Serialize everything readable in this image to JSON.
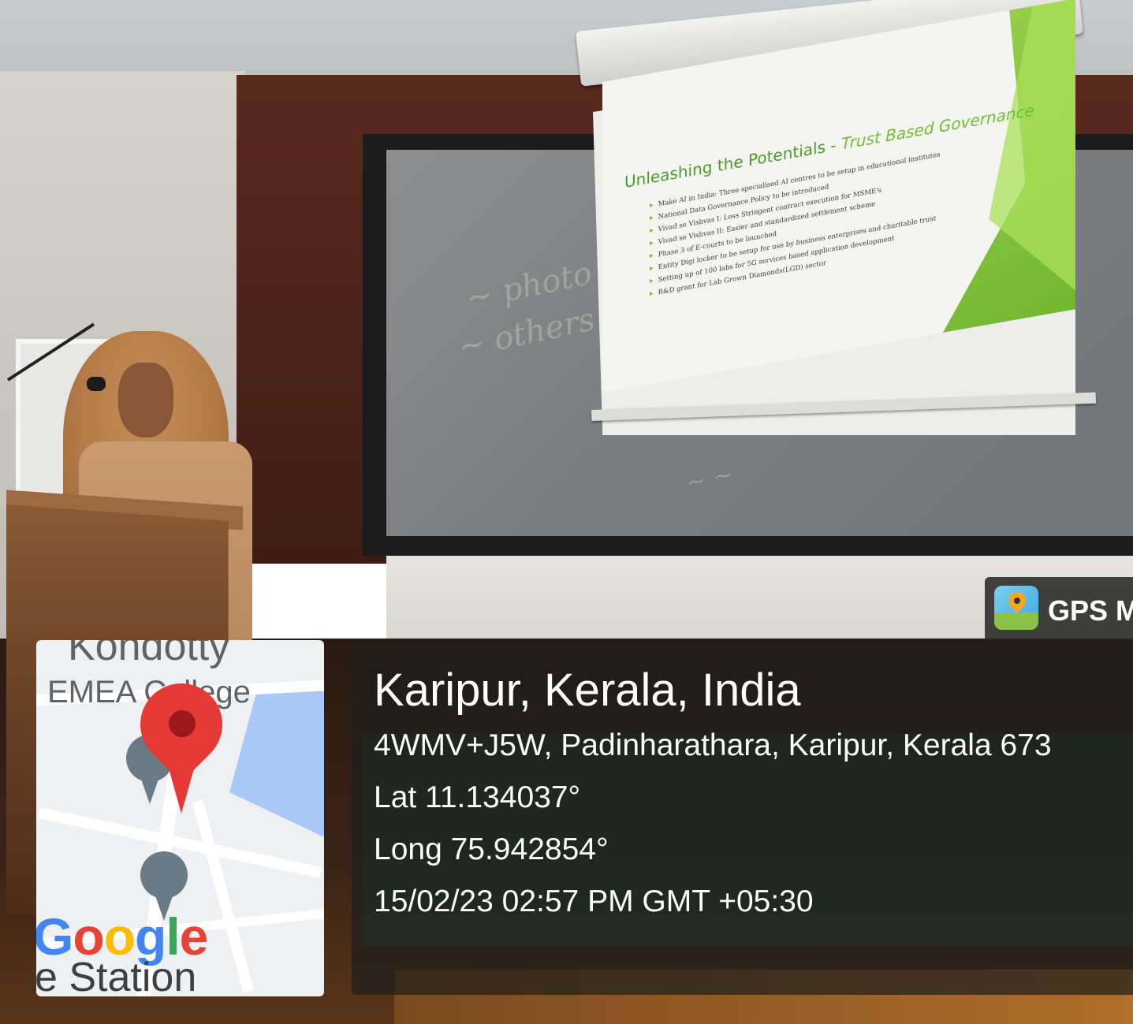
{
  "projected_slide": {
    "title_plain": "Unleashing the Potentials - ",
    "title_emphasis": "Trust Based Governance",
    "items": [
      "Make AI in India: Three specialised AI centres to be setup in educational institutes",
      "National Data Governance Policy to be introduced",
      "Vivad se Vishvas I: Less Stringent contract execution for MSME's",
      "Vivad se Vishvas II: Easier and standardized settlement scheme",
      "Phase 3 of E-courts to be launched",
      "Entity Digi locker to be setup for use by business enterprises and charitable trust",
      "Setting up of 100 labs for 5G services based application development",
      "R&D grant for Lab Grown Diamonds(LGD) sector"
    ]
  },
  "gps_tag": {
    "label": "GPS M",
    "icon": "map-camera-icon"
  },
  "location": {
    "title": "Karipur, Kerala, India",
    "address": "4WMV+J5W, Padinharathara, Karipur, Kerala 673",
    "lat": "Lat 11.134037°",
    "long": "Long 75.942854°",
    "datetime": "15/02/23 02:57 PM GMT +05:30"
  },
  "map": {
    "label_top": "Kondotty",
    "label_college": "EMEA College",
    "logo": "Google",
    "label_bottom": "e Station",
    "pin_icon": "location-pin-icon",
    "poi_icons": [
      "atm-icon",
      "police-icon"
    ],
    "colors": {
      "pin": "#e53935",
      "water": "#a9c8f5",
      "google_blue": "#4285F4",
      "google_red": "#EA4335",
      "google_yellow": "#FBBC05",
      "google_green": "#34A853"
    }
  }
}
